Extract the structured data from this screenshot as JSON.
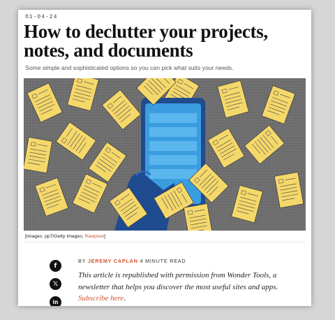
{
  "article": {
    "date": "01-04-24",
    "title": "How to declutter your projects, notes, and documents",
    "subtitle": "Some simple and sophisticated options so you can pick what suits your needs.",
    "caption_prefix": "[Images: pp7/Getty Images; ",
    "caption_link": "Rawpixel",
    "caption_suffix": "]",
    "byline_prefix": "BY",
    "author": "JEREMY CAPLAN",
    "read_time": "4 MINUTE READ",
    "intro_text": "This article is republished with permission from Wonder Tools, a newsletter that helps you discover the most useful sites and apps. ",
    "subscribe_link": "Subscribe here",
    "intro_end": "."
  },
  "share": {
    "facebook_glyph": "f",
    "x_glyph": "𝕏",
    "linkedin_glyph": "in"
  },
  "colors": {
    "accent": "#d0532e",
    "paper": "#f5d86a",
    "phone_screen": "#3a9de0",
    "hand": "#1f4b8f",
    "background_gray": "#6f6f6f"
  },
  "icons": [
    "facebook-icon",
    "x-icon",
    "linkedin-icon"
  ]
}
